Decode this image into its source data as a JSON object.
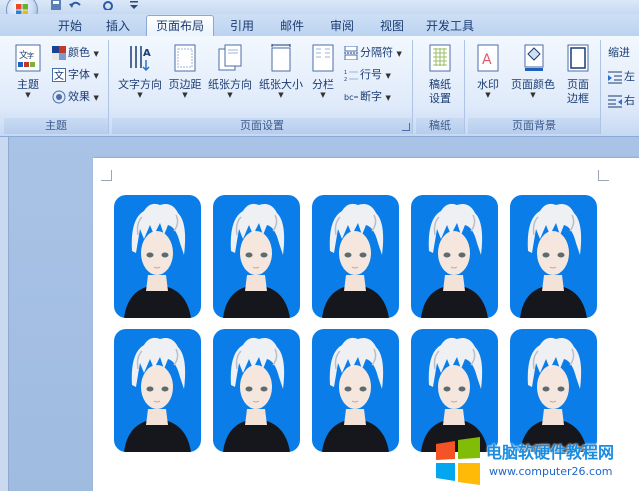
{
  "tabs": [
    {
      "label": "开始"
    },
    {
      "label": "插入"
    },
    {
      "label": "页面布局",
      "active": true
    },
    {
      "label": "引用"
    },
    {
      "label": "邮件"
    },
    {
      "label": "审阅"
    },
    {
      "label": "视图"
    },
    {
      "label": "开发工具"
    }
  ],
  "ribbon": {
    "theme_group": {
      "label": "主题",
      "theme_button": "主题",
      "colors": "颜色",
      "fonts": "字体",
      "effects": "效果"
    },
    "page_setup_group": {
      "label": "页面设置",
      "text_direction": "文字方向",
      "margins": "页边距",
      "orientation": "纸张方向",
      "size": "纸张大小",
      "columns": "分栏",
      "breaks": "分隔符",
      "line_numbers": "行号",
      "hyphenation": "断字"
    },
    "manuscript_group": {
      "label": "稿纸",
      "manuscript_settings_line1": "稿纸",
      "manuscript_settings_line2": "设置"
    },
    "page_background_group": {
      "label": "页面背景",
      "watermark": "水印",
      "page_color": "页面颜色",
      "page_borders_line1": "页面",
      "page_borders_line2": "边框"
    },
    "paragraph_group": {
      "indent": "缩进",
      "left": "左",
      "right": "右"
    }
  },
  "document": {
    "photo_rows": 2,
    "photo_cols": 5,
    "photo_bg_color": "#0a7de8"
  },
  "watermark": {
    "site_name": "电脑软硬件教程网",
    "site_url": "www.computer26.com"
  },
  "colors": {
    "ribbon_bg": "#dfeafa",
    "doc_bg": "#a9c3e6",
    "accent_text": "#15325f"
  }
}
